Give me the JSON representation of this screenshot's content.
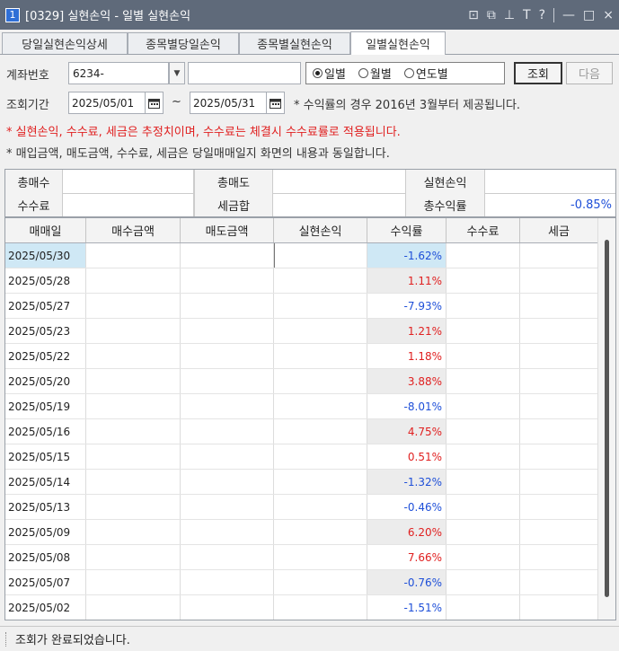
{
  "window": {
    "number": "1",
    "title": "[0329] 실현손익 - 일별 실현손익",
    "controls": [
      "⊡",
      "⧉",
      "⊥",
      "T",
      "?",
      "—",
      "□",
      "×"
    ]
  },
  "tabs": [
    {
      "label": "당일실현손익상세",
      "active": false
    },
    {
      "label": "종목별당일손익",
      "active": false
    },
    {
      "label": "종목별실현손익",
      "active": false
    },
    {
      "label": "일별실현손익",
      "active": true
    }
  ],
  "form": {
    "account_label": "계좌번호",
    "account_value": "6234-",
    "account_name": "",
    "radio_options": [
      {
        "label": "일별",
        "selected": true
      },
      {
        "label": "월별",
        "selected": false
      },
      {
        "label": "연도별",
        "selected": false
      }
    ],
    "query_button": "조회",
    "next_button": "다음",
    "period_label": "조회기간",
    "date_from": "2025/05/01",
    "date_to": "2025/05/31",
    "tilde": "~",
    "note1": "* 수익률의 경우 2016년 3월부터 제공됩니다.",
    "note2": "* 실현손익, 수수료, 세금은 추정치이며, 수수료는 체결시 수수료률로 적용됩니다.",
    "note3": "* 매입금액, 매도금액, 수수료, 세금은 당일매매일지 화면의 내용과 동일합니다."
  },
  "summary": {
    "total_buy_label": "총매수",
    "total_buy_value": "",
    "total_sell_label": "총매도",
    "total_sell_value": "",
    "realized_label": "실현손익",
    "realized_value": "",
    "fee_label": "수수료",
    "fee_value": "",
    "tax_label": "세금합",
    "tax_value": "",
    "total_return_label": "총수익률",
    "total_return_value": "-0.85%"
  },
  "table": {
    "headers": [
      "매매일",
      "매수금액",
      "매도금액",
      "실현손익",
      "수익률",
      "수수료",
      "세금"
    ],
    "rows": [
      {
        "date": "2025/05/30",
        "rate": "-1.62%",
        "sign": "neg"
      },
      {
        "date": "2025/05/28",
        "rate": "1.11%",
        "sign": "pos"
      },
      {
        "date": "2025/05/27",
        "rate": "-7.93%",
        "sign": "neg"
      },
      {
        "date": "2025/05/23",
        "rate": "1.21%",
        "sign": "pos"
      },
      {
        "date": "2025/05/22",
        "rate": "1.18%",
        "sign": "pos"
      },
      {
        "date": "2025/05/20",
        "rate": "3.88%",
        "sign": "pos"
      },
      {
        "date": "2025/05/19",
        "rate": "-8.01%",
        "sign": "neg"
      },
      {
        "date": "2025/05/16",
        "rate": "4.75%",
        "sign": "pos"
      },
      {
        "date": "2025/05/15",
        "rate": "0.51%",
        "sign": "pos"
      },
      {
        "date": "2025/05/14",
        "rate": "-1.32%",
        "sign": "neg"
      },
      {
        "date": "2025/05/13",
        "rate": "-0.46%",
        "sign": "neg"
      },
      {
        "date": "2025/05/09",
        "rate": "6.20%",
        "sign": "pos"
      },
      {
        "date": "2025/05/08",
        "rate": "7.66%",
        "sign": "pos"
      },
      {
        "date": "2025/05/07",
        "rate": "-0.76%",
        "sign": "neg"
      },
      {
        "date": "2025/05/02",
        "rate": "-1.51%",
        "sign": "neg"
      }
    ]
  },
  "status": {
    "message": "조회가 완료되었습니다."
  },
  "colors": {
    "positive": "#e02020",
    "negative": "#1e4fd8",
    "note_red": "#e02020",
    "selected_rate_bg": "#cfe8f5",
    "alt_rate_bg": "#ececec"
  }
}
